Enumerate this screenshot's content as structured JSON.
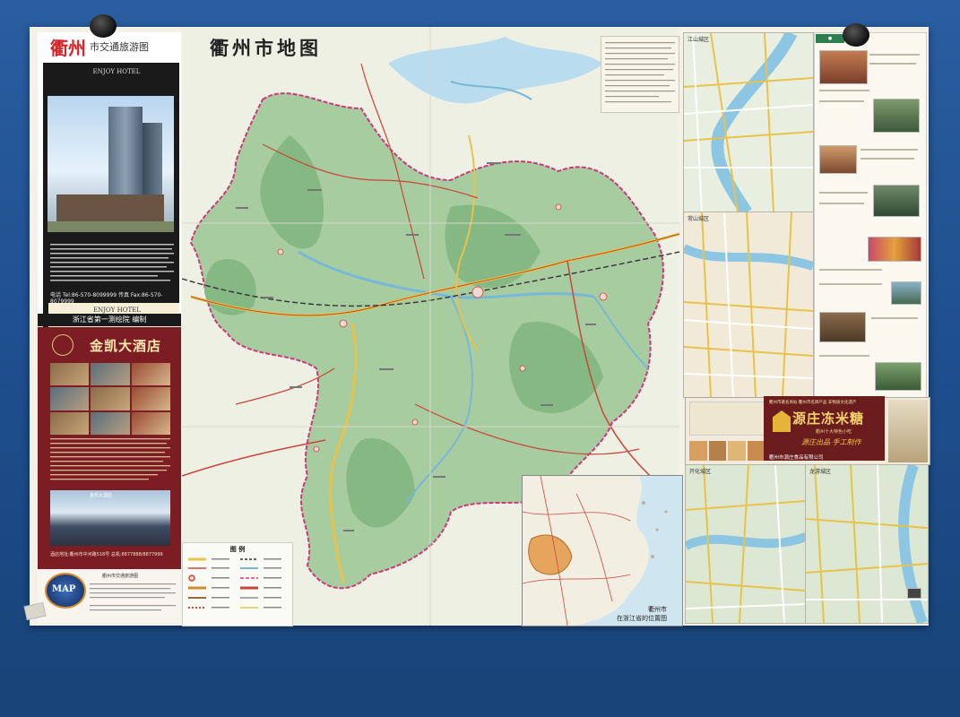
{
  "sheet": {
    "brand_big": "衢州",
    "brand_small": "市交通旅游图",
    "main_title": "衢州市地图",
    "legend_title": "图  例",
    "inset_caption_1": "衢州市",
    "inset_caption_2": "在浙江省的位置图",
    "editor_bar": "浙江省第一测绘院 编制"
  },
  "hotel_enjoy": {
    "logo": "ENJOY HOTEL",
    "phone": "电话 Tel:86-570-8099999  传真 Fax:86-570-8079999",
    "foot_logo": "ENJOY HOTEL"
  },
  "hotel_jinkai": {
    "name": "金凯大酒店",
    "photo_tag": "金凯大酒店",
    "contact": "酒店地址:衢州市中河路518号   总机:8877888/8877999"
  },
  "bottom_panel": {
    "logo": "MAP",
    "title": "衢州市交通旅游图"
  },
  "districts": {
    "top": "江山城区",
    "middle": "常山城区",
    "bottom_left": "开化城区",
    "bottom_right": "龙游城区"
  },
  "food_ad": {
    "tag": "衢州市著名商标  衢州市名牌产品  非物质文化遗产",
    "name": "源庄冻米糖",
    "sub": "衢州十大特色小吃",
    "slogan": "源庄出品  手工制作",
    "company": "衢州市源庄食品有限公司"
  },
  "colors": {
    "wall": "#1f4f8e",
    "paper": "#f4f1e6",
    "hotel2_red": "#7b1d22",
    "brand_red": "#d2262b",
    "map_green": "#8fb98a",
    "river_blue": "#79b7d6",
    "road_yellow": "#e8c34a",
    "road_red": "#c9463b"
  },
  "icons": [
    "pin-icon",
    "hotel-logo-icon",
    "map-globe-icon",
    "food-emblem-icon"
  ]
}
